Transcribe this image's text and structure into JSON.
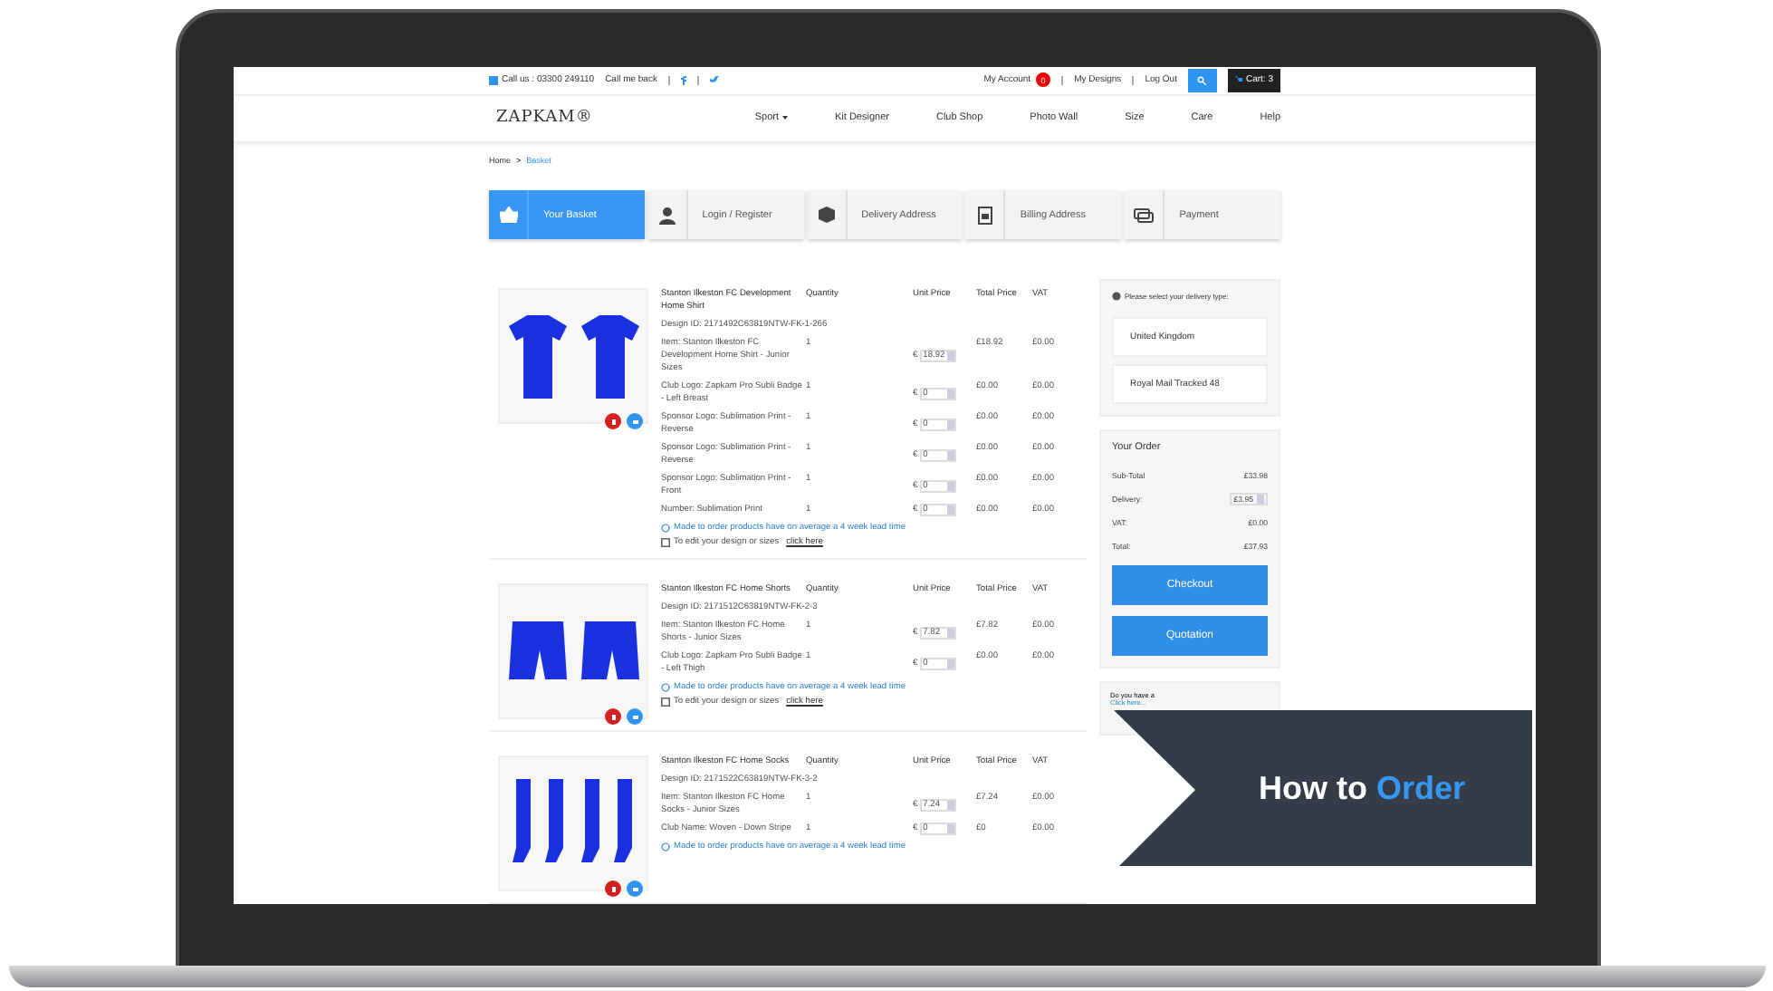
{
  "topbar": {
    "phone": "Call us : 03300 249110",
    "callback": "Call me back",
    "account": "My Account",
    "account_badge": "0",
    "designs": "My Designs",
    "logout": "Log Out",
    "cart": "Cart: 3"
  },
  "nav": {
    "logo": "ZAPKAM®",
    "items": [
      {
        "label": "Sport",
        "dropdown": true
      },
      {
        "label": "Kit Designer",
        "dropdown": false
      },
      {
        "label": "Club Shop",
        "dropdown": false
      },
      {
        "label": "Photo Wall",
        "dropdown": false
      },
      {
        "label": "Size",
        "dropdown": false
      },
      {
        "label": "Care",
        "dropdown": false
      },
      {
        "label": "Help",
        "dropdown": false
      }
    ]
  },
  "breadcrumb": {
    "items": [
      {
        "label": "Home",
        "selected": false
      },
      {
        "label": "Basket",
        "selected": true
      }
    ],
    "separator": ">"
  },
  "steps": [
    {
      "label": "Your Basket",
      "selected": true
    },
    {
      "label": "Login / Register",
      "selected": false
    },
    {
      "label": "Delivery Address",
      "selected": false
    },
    {
      "label": "Billing Address",
      "selected": false
    },
    {
      "label": "Payment",
      "selected": false
    }
  ],
  "products": [
    {
      "name": "Stanton Ilkeston FC Development Home Shirt",
      "columns": [
        "Quantity",
        "Unit Price",
        "Total Price",
        "VAT"
      ],
      "design_id": "Design ID: 2171492C63819NTW-FK-1-266",
      "lines": [
        {
          "item": "Item: Stanton Ilkeston FC Development Home Shirt - Junior Sizes",
          "qty": "1",
          "currency": "€",
          "unit": "18.92",
          "total": "£18.92",
          "vat": "£0.00"
        },
        {
          "item": "Club Logo: Zapkam Pro Subli Badge - Left Breast",
          "qty": "1",
          "currency": "€",
          "unit": "0",
          "total": "£0.00",
          "vat": "£0.00"
        },
        {
          "item": "Sponsor Logo: Sublimation Print - Reverse",
          "qty": "1",
          "currency": "€",
          "unit": "0",
          "total": "£0.00",
          "vat": "£0.00"
        },
        {
          "item": "Sponsor Logo: Sublimation Print - Reverse",
          "qty": "1",
          "currency": "€",
          "unit": "0",
          "total": "£0.00",
          "vat": "£0.00"
        },
        {
          "item": "Sponsor Logo: Sublimation Print - Front",
          "qty": "1",
          "currency": "€",
          "unit": "0",
          "total": "£0.00",
          "vat": "£0.00"
        },
        {
          "item": "Number: Sublimation Print",
          "qty": "1",
          "currency": "€",
          "unit": "0",
          "total": "£0.00",
          "vat": "£0.00"
        }
      ],
      "lead_note": "Made to order products have on average a 4 week lead time",
      "edit_note": "To edit your design or sizes",
      "edit_link": "click here"
    },
    {
      "name": "Stanton Ilkeston FC Home Shorts",
      "columns": [
        "Quantity",
        "Unit Price",
        "Total Price",
        "VAT"
      ],
      "design_id": "Design ID: 2171512C63819NTW-FK-2-3",
      "lines": [
        {
          "item": "Item: Stanton Ilkeston FC Home Shorts - Junior Sizes",
          "qty": "1",
          "currency": "€",
          "unit": "7.82",
          "total": "£7.82",
          "vat": "£0.00"
        },
        {
          "item": "Club Logo: Zapkam Pro Subli Badge - Left Thigh",
          "qty": "1",
          "currency": "€",
          "unit": "0",
          "total": "£0.00",
          "vat": "£0.00"
        }
      ],
      "lead_note": "Made to order products have on average a 4 week lead time",
      "edit_note": "To edit your design or sizes",
      "edit_link": "click here"
    },
    {
      "name": "Stanton Ilkeston FC Home Socks",
      "columns": [
        "Quantity",
        "Unit Price",
        "Total Price",
        "VAT"
      ],
      "design_id": "Design ID: 2171522C63819NTW-FK-3-2",
      "lines": [
        {
          "item": "Item: Stanton Ilkeston FC Home Socks - Junior Sizes",
          "qty": "1",
          "currency": "€",
          "unit": "7.24",
          "total": "£7.24",
          "vat": "£0.00"
        },
        {
          "item": "Club Name: Woven - Down Stripe",
          "qty": "1",
          "currency": "€",
          "unit": "0",
          "total": "£0",
          "vat": "£0.00"
        }
      ],
      "lead_note": "Made to order products have on average a 4 week lead time"
    }
  ],
  "delivery": {
    "prompt": "Please select your delivery type:",
    "options": [
      "United Kingdom",
      "Royal Mail Tracked 48"
    ]
  },
  "order": {
    "title": "Your Order",
    "rows": [
      {
        "label": "Sub-Total",
        "value": "£33.98",
        "kind": "text"
      },
      {
        "label": "Delivery:",
        "value": "£3.95",
        "kind": "spinner"
      },
      {
        "label": "VAT:",
        "value": "£0.00",
        "kind": "text"
      },
      {
        "label": "Total:",
        "value": "£37.93",
        "kind": "text"
      }
    ],
    "buttons": [
      "Checkout",
      "Quotation"
    ]
  },
  "promo": {
    "text": "Do you have a",
    "link": "Click here..."
  },
  "banner": {
    "text": "How to",
    "highlight": "Order"
  }
}
